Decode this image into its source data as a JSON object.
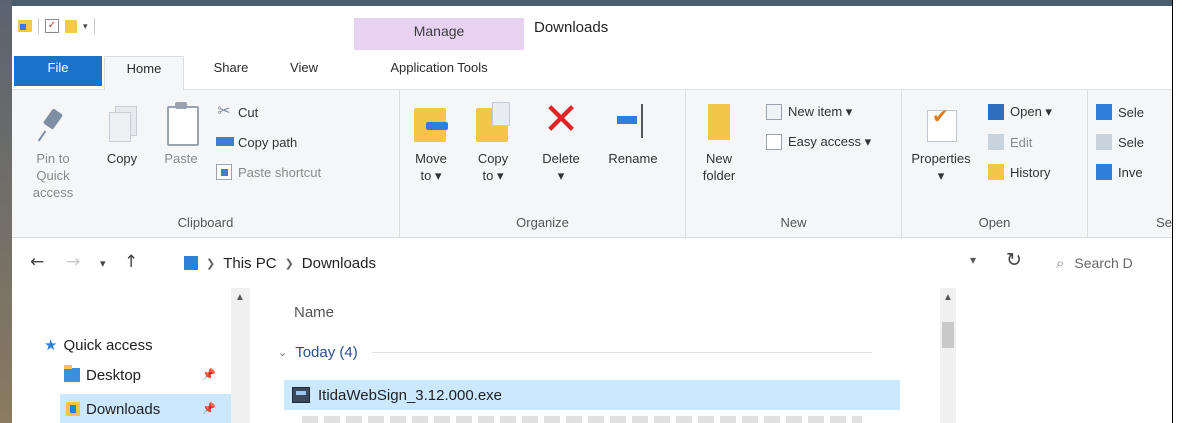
{
  "window": {
    "title": "Downloads",
    "contextual_tab_group": "Manage"
  },
  "tabs": {
    "file": "File",
    "home": "Home",
    "share": "Share",
    "view": "View",
    "application_tools": "Application Tools"
  },
  "ribbon": {
    "clipboard": {
      "label": "Clipboard",
      "pin_line1": "Pin to Quick",
      "pin_line2": "access",
      "copy": "Copy",
      "paste": "Paste",
      "cut": "Cut",
      "copy_path": "Copy path",
      "paste_shortcut": "Paste shortcut"
    },
    "organize": {
      "label": "Organize",
      "move_line1": "Move",
      "move_line2": "to ▾",
      "copy_line1": "Copy",
      "copy_line2": "to ▾",
      "delete_line1": "Delete",
      "delete_line2": "▾",
      "rename": "Rename"
    },
    "new": {
      "label": "New",
      "new_folder_line1": "New",
      "new_folder_line2": "folder",
      "new_item": "New item ▾",
      "easy_access": "Easy access ▾"
    },
    "open": {
      "label": "Open",
      "properties_line1": "Properties",
      "properties_line2": "▾",
      "open": "Open ▾",
      "edit": "Edit",
      "history": "History"
    },
    "select": {
      "label": "Se",
      "select_all": "Sele",
      "select_none": "Sele",
      "invert": "Inve"
    }
  },
  "address": {
    "crumb_root": "This PC",
    "crumb_current": "Downloads",
    "search_placeholder": "Search D"
  },
  "nav_pane": {
    "quick_access": "Quick access",
    "desktop": "Desktop",
    "downloads": "Downloads"
  },
  "file_list": {
    "column_name": "Name",
    "group_today": "Today (4)",
    "selected_file": "ItidaWebSign_3.12.000.exe"
  },
  "colors": {
    "file_tab": "#1a73c9",
    "manage_tab": "#e7d3f1",
    "selection": "#cce8ff",
    "delete_icon": "#e02424"
  }
}
